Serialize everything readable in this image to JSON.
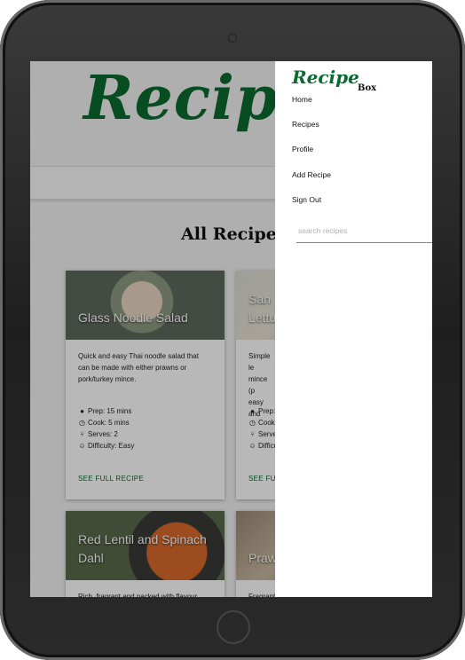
{
  "site": {
    "hero_logo": "Recip",
    "page_title": "All Recipes"
  },
  "cards": [
    {
      "title": "Glass Noodle Salad",
      "description": "Quick and easy Thai noodle salad that can be made with either prawns or pork/turkey mince.",
      "prep": "Prep: 15 mins",
      "cook": "Cook: 5 mins",
      "serves": "Serves: 2",
      "difficulty": "Difficulty: Easy",
      "link": "SEE FULL RECIPE"
    },
    {
      "title": "San Lettu",
      "description": "Simple le mince (p easy and",
      "prep": "Prep:",
      "cook": "Cook:",
      "serves": "Serve",
      "difficulty": "Difficu",
      "link": "SEE FU"
    },
    {
      "title": "Red Lentil and Spinach Dahl",
      "description": "Rich, fragrant and packed with flavour"
    },
    {
      "title": "Praw",
      "description": "Fragrant"
    }
  ],
  "drawer": {
    "logo_top": "Recipe",
    "logo_bottom": "Box",
    "nav": [
      "Home",
      "Recipes",
      "Profile",
      "Add Recipe",
      "Sign Out"
    ],
    "search_placeholder": "search recipes",
    "search_value": ""
  },
  "colors": {
    "brand": "#0a6b2f"
  },
  "icons": [
    "clock-icon",
    "timer-icon",
    "cutlery-icon",
    "smiley-icon",
    "search-icon"
  ]
}
